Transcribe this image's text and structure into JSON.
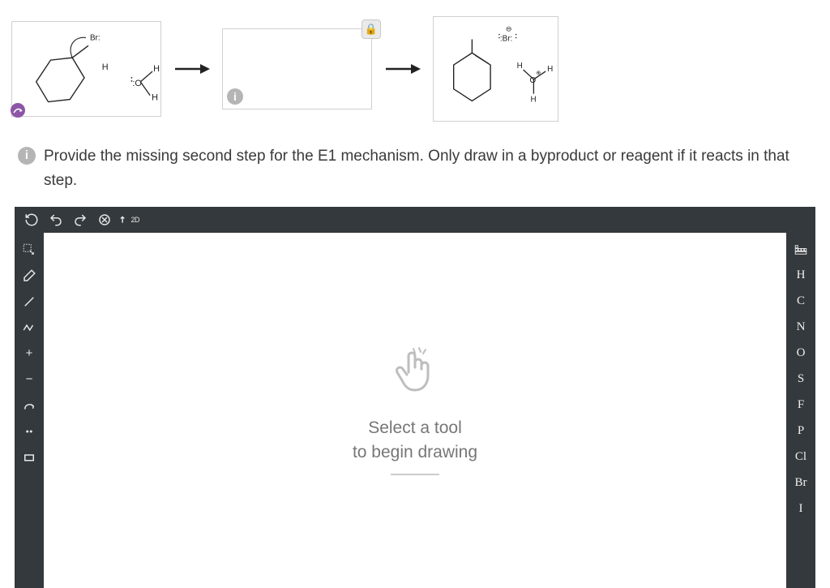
{
  "panel1_alt": "1-bromo-1-methylcyclohexane substrate with adjacent H, plus H2O (:O with two H)",
  "panel3_alt": "1-methylcyclohexene product, :Br:- anion, and H3O+",
  "lock_glyph": "🔒",
  "instruction": "Provide the missing second step for the E1 mechanism. Only draw in a byproduct or reagent if it reacts in that step.",
  "info_glyph": "i",
  "canvas_msg_line1": "Select a tool",
  "canvas_msg_line2": "to begin drawing",
  "top_tools": {
    "reset": "⟳",
    "undo": "↶",
    "redo": "↷",
    "zoomfit": "⊗",
    "view2d": "2D"
  },
  "left_tools": {
    "select": "select",
    "erase": "erase",
    "bond": "bond",
    "chain": "chain",
    "plus": "+",
    "minus": "−",
    "curved_arrow": "arrow",
    "lone_pair": "lonepair",
    "rect": "rect"
  },
  "right_tools": {
    "periodic": "table",
    "elements": [
      "H",
      "C",
      "N",
      "O",
      "S",
      "F",
      "P",
      "Cl",
      "Br",
      "I"
    ]
  }
}
